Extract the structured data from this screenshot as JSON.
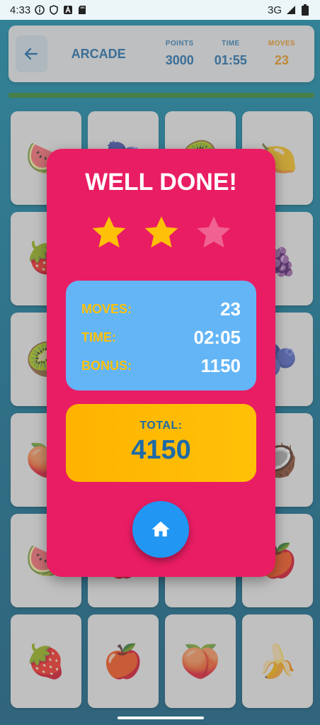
{
  "status_bar": {
    "time": "4:33",
    "network": "3G",
    "icons": [
      "info-icon",
      "shield-icon",
      "a-badge-icon",
      "sd-card-icon",
      "signal-icon",
      "battery-icon"
    ]
  },
  "header": {
    "back_icon": "arrow-left-icon",
    "mode": "ARCADE",
    "points_label": "POINTS",
    "points_value": "3000",
    "time_label": "TIME",
    "time_value": "01:55",
    "moves_label": "MOVES",
    "moves_value": "23"
  },
  "grid": {
    "tiles": [
      "🍉",
      "🫐",
      "🥝",
      "🍋",
      "🍓",
      "🍇",
      "🍎",
      "🍇",
      "🥝",
      "🍋",
      "🍑",
      "🫐",
      "🍑",
      "🍓",
      "🍌",
      "🥥",
      "🍉",
      "🍎",
      "🍉",
      "🍎",
      "🍓",
      "🍎",
      "🍑",
      "🍌"
    ]
  },
  "dialog": {
    "title": "WELL DONE!",
    "stars_earned": 2,
    "stars_total": 3,
    "moves_label": "MOVES:",
    "moves_value": "23",
    "time_label": "TIME:",
    "time_value": "02:05",
    "bonus_label": "BONUS:",
    "bonus_value": "1150",
    "total_label": "TOTAL:",
    "total_value": "4150",
    "home_icon": "home-icon"
  },
  "colors": {
    "dialog_bg": "#e91d63",
    "stats_bg": "#64b5f6",
    "total_bg": "#ffb300",
    "accent_blue": "#1e6aa8",
    "star_filled": "#ffc107",
    "star_empty": "#f06292",
    "home_button": "#2196f3"
  }
}
